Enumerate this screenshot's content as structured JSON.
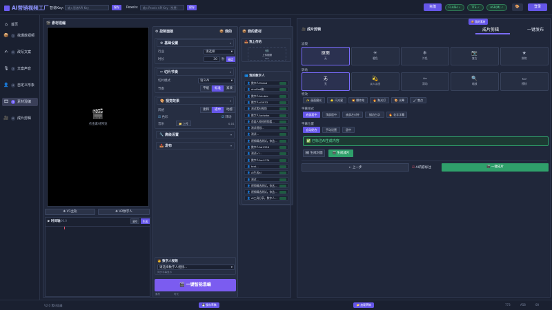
{
  "app": {
    "title": "AI营销视频工厂"
  },
  "topbar": {
    "key_label": "智谱Key:",
    "key_placeholder": "输入智谱API Key",
    "key_save": "保存",
    "pexels_label": "Pexels:",
    "pexels_placeholder": "输入Pexels API Key（免费）",
    "pexels_save": "保存",
    "btn_account": "充值",
    "status_flash": "FLASH ✓",
    "status_tts": "TTS ✓",
    "status_asr": "ASR(M) ✓",
    "btn_login": "登录"
  },
  "sidebar": {
    "items": [
      {
        "num": "",
        "label": "首页",
        "icon": "home-icon"
      },
      {
        "num": "1",
        "label": "找爆款视频",
        "icon": "box-icon"
      },
      {
        "num": "2",
        "label": "改写文案",
        "icon": "pen-icon"
      },
      {
        "num": "3",
        "label": "文案声音",
        "icon": "mic-icon"
      },
      {
        "num": "4",
        "label": "自定义形象",
        "icon": "person-icon"
      },
      {
        "num": "5",
        "label": "素材混编",
        "icon": "film-icon"
      },
      {
        "num": "6",
        "label": "成片剪辑",
        "icon": "video-icon"
      }
    ]
  },
  "mix": {
    "title": "素材混编",
    "preview_text": "点击素材预览",
    "btn_v1": "V1主轨",
    "btn_v2": "V2数字人",
    "timeline_label": "时间轴",
    "timeline_time": "00.0",
    "timeline_btn_clear": "清空",
    "timeline_btn_generate": "生成"
  },
  "control": {
    "title": "控制面板",
    "my_title": "我的",
    "basic": {
      "title": "基础设置",
      "industry_label": "行业",
      "industry_value": "请选择",
      "duration_label": "时长",
      "duration_value": "30",
      "duration_unit": "秒",
      "confirm": "确定"
    },
    "rhythm": {
      "title": "切片节奏",
      "mode_label": "切片模式",
      "mode_value": "语义AI",
      "tempo_label": "节奏",
      "tempo_options": [
        "平缓",
        "标准",
        "紧凑"
      ],
      "tempo_active": 1
    },
    "visual": {
      "title": "视觉效果",
      "style_label": "风格",
      "style_options": [
        "柔和",
        "适中",
        "动感"
      ],
      "style_active": 1,
      "check_a": "色彩",
      "check_b": "转场",
      "music_label": "音乐",
      "music_btn": "上传",
      "music_value": "0.1S"
    },
    "advanced": {
      "title": "高级设置"
    },
    "publish": {
      "title": "发布"
    },
    "digital": {
      "title": "数字人视频",
      "select_placeholder": "请选择数字人视频...",
      "hint": "同步字幕显示"
    },
    "btn_oneclick": "一键智能混编",
    "footer_a": "素材",
    "footer_b": "时长"
  },
  "materials": {
    "title": "我的素材",
    "upload_section": "我上传的",
    "upload_label": "上传视频",
    "upload_hint": "MP4",
    "digital_section": "我的数字人",
    "digital_items": [
      "数字人Mrdad",
      "ehuflad编...",
      "数字人Ahuble",
      "数字人ci5933",
      "测试素材视频",
      "数字人Aadwba",
      "首届人物短视频看...",
      "测试视频...",
      "测试...",
      "视频精选测试。你这...",
      "数字人Ab1336",
      "测试u1...",
      "数字人Am1Y3t",
      "test...",
      "AI生成ai",
      "测试...",
      "视频精选测试。你这...",
      "视频精选测试。你这...",
      "AI工具分享。数字人..."
    ]
  },
  "editor": {
    "title": "成片剪辑",
    "badge": "我的素材",
    "tabs": [
      "成片剪辑",
      "一键发布"
    ],
    "filter_label": "滤镜",
    "filters": [
      {
        "name": "原图",
        "sub": "无",
        "icon": ""
      },
      {
        "name": "",
        "sub": "暖色",
        "icon": "☀"
      },
      {
        "name": "",
        "sub": "冷色",
        "icon": "❄"
      },
      {
        "name": "",
        "sub": "复古",
        "icon": "📷"
      },
      {
        "name": "",
        "sub": "鲜艳",
        "icon": "★"
      }
    ],
    "transition_label": "转场",
    "transitions": [
      {
        "name": "无",
        "sub": "无",
        "icon": ""
      },
      {
        "name": "",
        "sub": "淡入淡出",
        "icon": "💫"
      },
      {
        "name": "",
        "sub": "滑动",
        "icon": "⇦"
      },
      {
        "name": "",
        "sub": "缩放",
        "icon": "🔍"
      },
      {
        "name": "",
        "sub": "擦除",
        "icon": "▭"
      }
    ],
    "effects_label": "特效",
    "effects": [
      "✨ 画面磨光",
      "⭐ 闪光星",
      "💥 爆炸效",
      "🔥 聚光灯",
      "🎨 光晕",
      "🖌 散点"
    ],
    "subtitle_label": "字幕样式",
    "subtitles": [
      "底部居中",
      "顶部居中",
      "底部左对齐",
      "描边白字",
      "🔥 花字字幕"
    ],
    "subtitle_active": 0,
    "position_label": "字幕位置",
    "positions": [
      "自动贴合",
      "手动设置",
      "居中"
    ],
    "position_active": 0,
    "notice": "已标注AI生成内容",
    "btn_cover": "生成封面",
    "btn_video": "生成成片",
    "btn_prev": "← 上一步",
    "check_ai": "AI内容标注",
    "btn_finish": "一键成片"
  },
  "footer": {
    "version": "V2.0 素材混编",
    "btn_save": "保存草稿",
    "btn_export": "加载草稿",
    "stat_a": "773",
    "stat_b": "A58",
    "stat_c": "00"
  },
  "colors": {
    "accent": "#6556e8",
    "success": "#2fa06b",
    "bg": "#1c2233"
  }
}
